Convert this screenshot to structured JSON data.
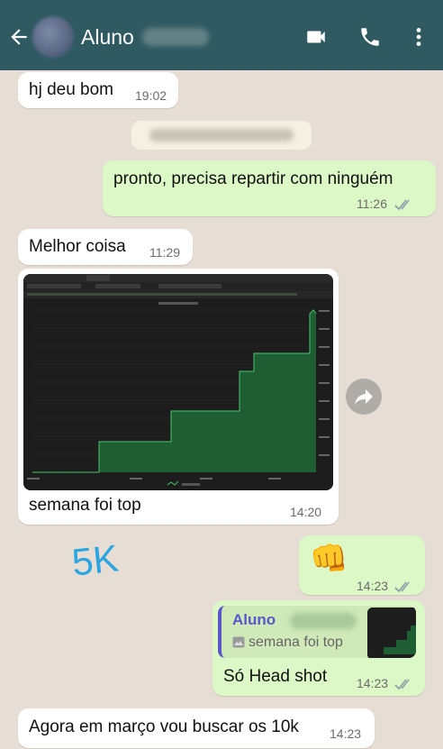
{
  "header": {
    "contact_name": "Aluno",
    "back_icon": "arrow-left-icon",
    "video_icon": "video-camera-icon",
    "call_icon": "phone-icon",
    "menu_icon": "more-vert-icon",
    "bg_color": "#2f5a62"
  },
  "messages": [
    {
      "text": "hj deu bom",
      "time": "19:02",
      "direction": "incoming"
    },
    {
      "text": "pronto, precisa repartir com ninguém",
      "time": "11:26",
      "direction": "outgoing",
      "status": "read"
    },
    {
      "text": "Melhor coisa",
      "time": "11:29",
      "direction": "incoming"
    },
    {
      "caption": "semana foi top",
      "time": "14:20",
      "direction": "incoming",
      "type": "image"
    },
    {
      "emoji": "👊",
      "time": "14:23",
      "direction": "outgoing",
      "status": "read"
    },
    {
      "quote_name": "Aluno",
      "quote_text": "semana foi top",
      "text": "Só Head shot",
      "time": "14:23",
      "direction": "outgoing",
      "status": "read"
    },
    {
      "text": "Agora em março vou buscar os 10k",
      "time": "14:23",
      "direction": "incoming"
    }
  ],
  "annotation": "5K",
  "colors": {
    "incoming_bubble": "#ffffff",
    "outgoing_bubble": "#dcf8c6",
    "chat_bg": "#e6ded4",
    "read_ticks": "#8a9aa5",
    "quote_accent": "#5b56c8",
    "annotation": "#2aa5e0"
  }
}
